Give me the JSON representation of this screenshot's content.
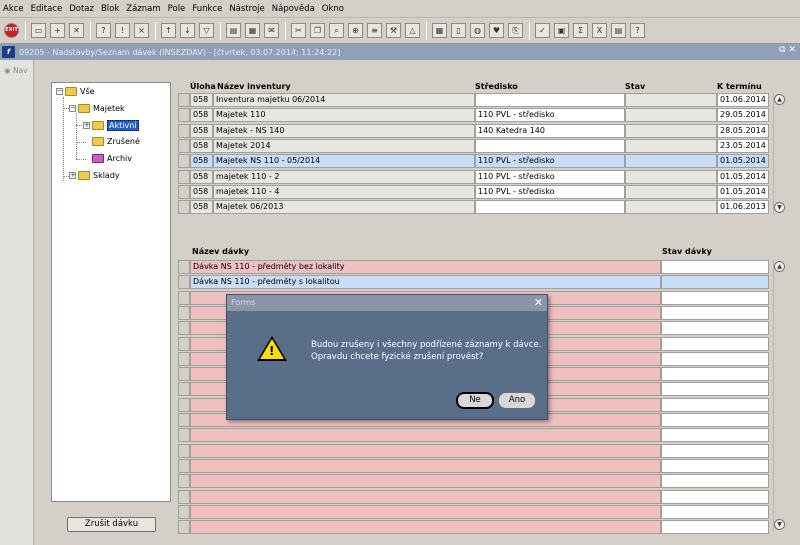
{
  "menu": [
    "Akce",
    "Editace",
    "Dotaz",
    "Blok",
    "Záznam",
    "Pole",
    "Funkce",
    "Nástroje",
    "Nápověda",
    "Okno"
  ],
  "toolbar": {
    "stop_label": "EXIT"
  },
  "window": {
    "title": "09205 - Nadstavby/Seznam dávek (INSEZDAV) - [čtvrtek, 03.07.2014; 11:24:22]"
  },
  "nav": {
    "label": "Nav"
  },
  "tree": {
    "root": "Vše",
    "majetek": "Majetek",
    "aktivni": "Aktivní",
    "zrusene": "Zrušené",
    "archiv": "Archiv",
    "sklady": "Sklady"
  },
  "inventory": {
    "headers": {
      "uloha": "Úloha",
      "nazev": "Název inventury",
      "stredisko": "Středisko",
      "stav": "Stav",
      "termin": "K termínu"
    },
    "rows": [
      {
        "uloha": "058",
        "nazev": "Inventura majetku 06/2014",
        "stredisko": "",
        "stav": "",
        "termin": "01.06.2014"
      },
      {
        "uloha": "058",
        "nazev": "Majetek 110",
        "stredisko": "110 PVL - středisko",
        "stav": "",
        "termin": "29.05.2014"
      },
      {
        "uloha": "058",
        "nazev": "Majetek - NS 140",
        "stredisko": "140 Katedra 140",
        "stav": "",
        "termin": "28.05.2014"
      },
      {
        "uloha": "058",
        "nazev": "Majetek 2014",
        "stredisko": "",
        "stav": "",
        "termin": "23.05.2014"
      },
      {
        "uloha": "058",
        "nazev": "Majetek NS 110 - 05/2014",
        "stredisko": "110 PVL - středisko",
        "stav": "",
        "termin": "01.05.2014"
      },
      {
        "uloha": "058",
        "nazev": "majetek 110 - 2",
        "stredisko": "110 PVL - středisko",
        "stav": "",
        "termin": "01.05.2014"
      },
      {
        "uloha": "058",
        "nazev": "majetek 110 - 4",
        "stredisko": "110 PVL - středisko",
        "stav": "",
        "termin": "01.05.2014"
      },
      {
        "uloha": "058",
        "nazev": "Majetek 06/2013",
        "stredisko": "",
        "stav": "",
        "termin": "01.06.2013"
      }
    ]
  },
  "batches": {
    "headers": {
      "nazev": "Název dávky",
      "stav": "Stav dávky"
    },
    "rows": [
      {
        "nazev": "Dávka NS 110 - předměty bez lokality",
        "stav": ""
      },
      {
        "nazev": "Dávka NS 110 - předměty s lokalitou",
        "stav": ""
      }
    ]
  },
  "button": {
    "zrusit": "Zrušit dávku"
  },
  "dialog": {
    "title": "Forms",
    "line1": "Budou zrušeny i všechny podřízené záznamy k dávce.",
    "line2": "Opravdu chcete fyzické zrušení provést?",
    "ne": "Ne",
    "ano": "Ano"
  }
}
